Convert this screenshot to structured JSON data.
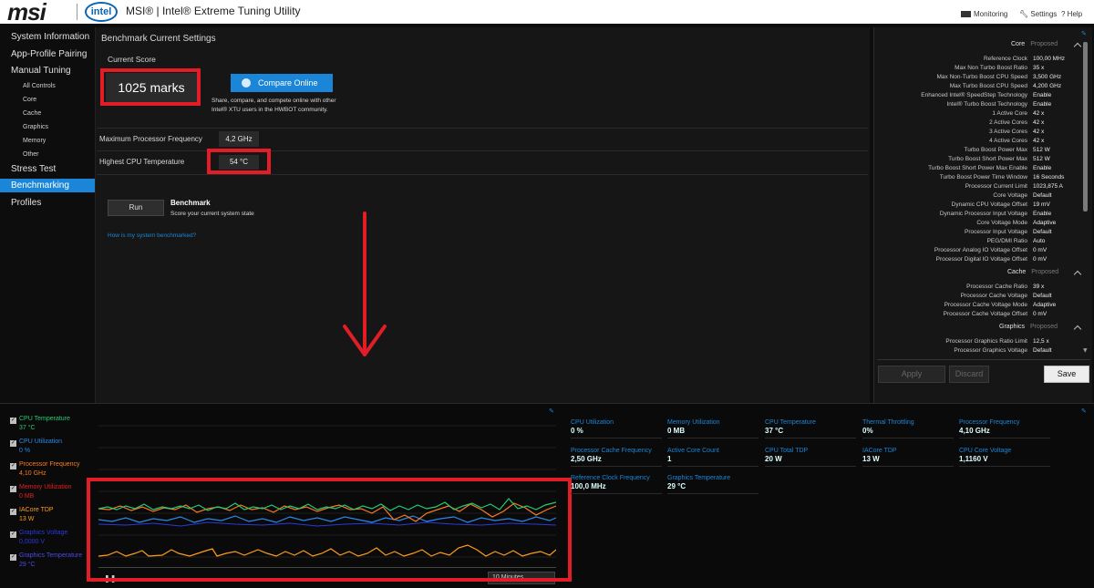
{
  "titlebar": {
    "logo": "msi",
    "intel_logo": "intel",
    "title": "MSI® | Intel® Extreme Tuning Utility",
    "monitoring": "Monitoring",
    "settings": "Settings",
    "help": "Help"
  },
  "sidebar": {
    "items": [
      "System Information",
      "App-Profile Pairing",
      "Manual Tuning",
      "All Controls",
      "Core",
      "Cache",
      "Graphics",
      "Memory",
      "Other",
      "Stress Test",
      "Benchmarking",
      "Profiles"
    ],
    "active": "Benchmarking"
  },
  "main": {
    "heading": "Benchmark Current Settings",
    "current_score_label": "Current Score",
    "score": "1025 marks",
    "compare_label": "Compare Online",
    "compare_desc_1": "Share, compare, and compete online with other",
    "compare_desc_2": "Intel® XTU users in the HWBOT community.",
    "max_freq_label": "Maximum Processor Frequency",
    "max_freq_value": "4,2  GHz",
    "max_temp_label": "Highest CPU Temperature",
    "max_temp_value": "54 °C",
    "run_label": "Run",
    "benchmark_title": "Benchmark",
    "benchmark_desc": "Score your current system state",
    "link": "How is my system benchmarked?"
  },
  "right": {
    "core_section": "Core",
    "proposed": "Proposed",
    "core_rows": [
      [
        "Reference Clock",
        "100,00 MHz"
      ],
      [
        "Max Non Turbo Boost Ratio",
        "35 x"
      ],
      [
        "Max Non-Turbo Boost CPU Speed",
        "3,500 GHz"
      ],
      [
        "Max Turbo Boost CPU Speed",
        "4,200 GHz"
      ],
      [
        "Enhanced Intel® SpeedStep Technology",
        "Enable"
      ],
      [
        "Intel® Turbo Boost Technology",
        "Enable"
      ],
      [
        "1 Active Core",
        "42 x"
      ],
      [
        "2 Active Cores",
        "42 x"
      ],
      [
        "3 Active Cores",
        "42 x"
      ],
      [
        "4 Active Cores",
        "42 x"
      ],
      [
        "Turbo Boost Power Max",
        "512 W"
      ],
      [
        "Turbo Boost Short Power Max",
        "512 W"
      ],
      [
        "Turbo Boost Short Power Max Enable",
        "Enable"
      ],
      [
        "Turbo Boost Power Time Window",
        "16 Seconds"
      ],
      [
        "Processor Current Limit",
        "1023,875 A"
      ],
      [
        "Core Voltage",
        "Default"
      ],
      [
        "Dynamic CPU Voltage Offset",
        "19 mV"
      ],
      [
        "Dynamic Processor Input Voltage",
        "Enable"
      ],
      [
        "Core Voltage Mode",
        "Adaptive"
      ],
      [
        "Processor Input Voltage",
        "Default"
      ],
      [
        "PEG/DMI Ratio",
        "Auto"
      ],
      [
        "Processor Analog IO Voltage Offset",
        "0 mV"
      ],
      [
        "Processor Digital IO Voltage Offset",
        "0 mV"
      ]
    ],
    "cache_section": "Cache",
    "cache_rows": [
      [
        "Processor Cache Ratio",
        "39 x"
      ],
      [
        "Processor Cache Voltage",
        "Default"
      ],
      [
        "Processor Cache Voltage Mode",
        "Adaptive"
      ],
      [
        "Processor Cache Voltage Offset",
        "0 mV"
      ]
    ],
    "graphics_section": "Graphics",
    "graphics_rows": [
      [
        "Processor Graphics Ratio Limit",
        "12,5 x"
      ],
      [
        "Processor Graphics Voltage",
        "Default"
      ]
    ],
    "apply": "Apply",
    "discard": "Discard",
    "save": "Save"
  },
  "monitor": {
    "legend": [
      {
        "name": "CPU Temperature",
        "value": "37 °C",
        "color": "#22cc77"
      },
      {
        "name": "CPU Utilization",
        "value": "0 %",
        "color": "#2a88e8"
      },
      {
        "name": "Processor Frequency",
        "value": "4,10 GHz",
        "color": "#ff7a1a"
      },
      {
        "name": "Memory Utilization",
        "value": "0  MB",
        "color": "#e02020"
      },
      {
        "name": "IACore TDP",
        "value": "13 W",
        "color": "#ff9c1a"
      },
      {
        "name": "Graphics Voltage",
        "value": "0,0000 V",
        "color": "#2a3ad8"
      },
      {
        "name": "Graphics Temperature",
        "value": "29 °C",
        "color": "#4a4ae8"
      }
    ],
    "stats": [
      {
        "title": "CPU Utilization",
        "value": "0 %"
      },
      {
        "title": "Memory Utilization",
        "value": "0  MB"
      },
      {
        "title": "CPU Temperature",
        "value": "37 °C"
      },
      {
        "title": "Thermal Throttling",
        "value": "0%"
      },
      {
        "title": "Processor Frequency",
        "value": "4,10 GHz"
      },
      {
        "title": "Processor Cache Frequency",
        "value": "2,50 GHz"
      },
      {
        "title": "Active Core Count",
        "value": "1"
      },
      {
        "title": "CPU Total TDP",
        "value": "20 W"
      },
      {
        "title": "IACore TDP",
        "value": "13 W"
      },
      {
        "title": "CPU Core Voltage",
        "value": "1,1160 V"
      },
      {
        "title": "Reference Clock Frequency",
        "value": "100,0 MHz"
      },
      {
        "title": "Graphics Temperature",
        "value": "29 °C"
      }
    ],
    "time_range": "10 Minutes"
  }
}
